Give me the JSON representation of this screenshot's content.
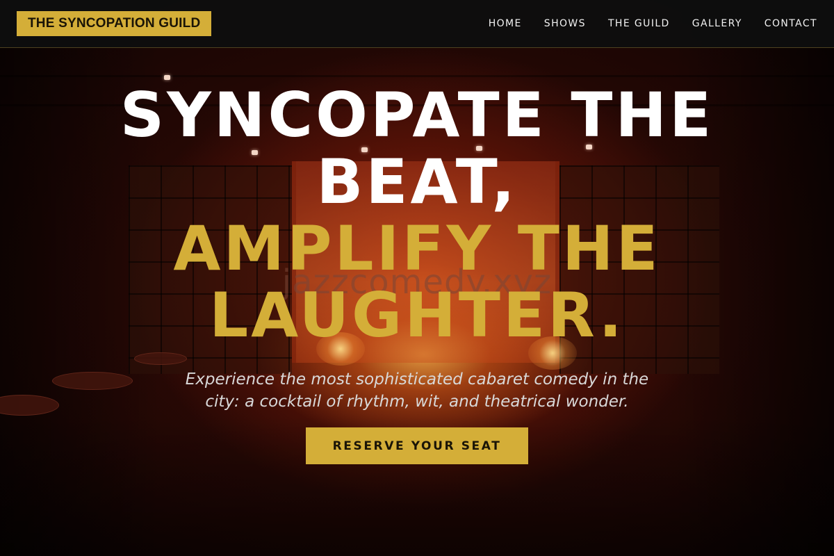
{
  "site": {
    "logo_text": "THE SYNCOPATION GUILD"
  },
  "nav": {
    "items": [
      {
        "label": "HOME"
      },
      {
        "label": "SHOWS"
      },
      {
        "label": "THE GUILD"
      },
      {
        "label": "GALLERY"
      },
      {
        "label": "CONTACT"
      }
    ]
  },
  "hero": {
    "headline_line1": "SYNCOPATE THE BEAT,",
    "headline_line2": "AMPLIFY THE LAUGHTER.",
    "tagline": "Experience the most sophisticated cabaret comedy in the city: a cocktail of rhythm, wit, and theatrical wonder.",
    "cta_label": "RESERVE YOUR SEAT",
    "watermark": "jazzcomedy.xyz"
  },
  "colors": {
    "accent": "#d4ae38",
    "header_bg": "#0e0e0e",
    "headline_white": "#ffffff",
    "tagline": "#d8d8d8"
  }
}
